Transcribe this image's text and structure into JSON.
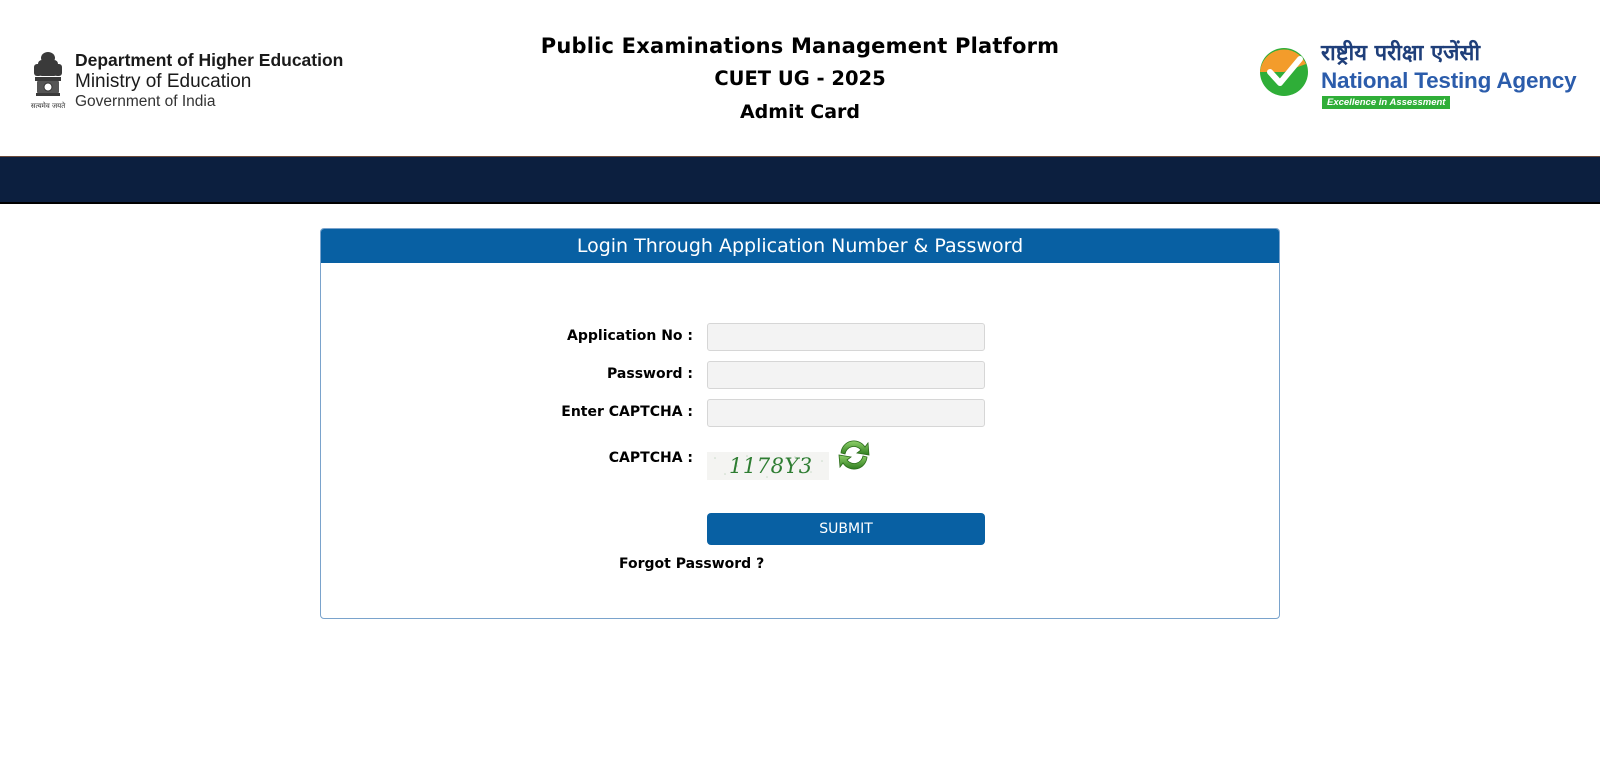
{
  "header": {
    "department": {
      "line1": "Department of Higher Education",
      "line2": "Ministry of Education",
      "line3": "Government of India",
      "emblem_caption": "सत्यमेव जयते"
    },
    "titles": {
      "platform": "Public Examinations Management Platform",
      "exam": "CUET UG - 2025",
      "document": "Admit Card"
    },
    "agency": {
      "hindi_name": "राष्ट्रीय परीक्षा एजेंसी",
      "english_name": "National Testing Agency",
      "tagline": "Excellence in Assessment"
    }
  },
  "login": {
    "heading": "Login Through Application Number & Password",
    "application_no_label": "Application No :",
    "application_no_value": "",
    "password_label": "Password :",
    "password_value": "",
    "captcha_input_label": "Enter CAPTCHA :",
    "captcha_input_value": "",
    "captcha_label": "CAPTCHA :",
    "captcha_text": "1178Y3",
    "submit_label": "SUBMIT",
    "forgot_label": "Forgot Password ?"
  },
  "colors": {
    "navbar": "#0c1f3f",
    "panel_header": "#0860a3",
    "submit": "#0860a3",
    "nta_blue": "#2b5cab",
    "nta_green": "#2fae38",
    "nta_orange": "#f39c2b",
    "captcha_text": "#2e7d32"
  },
  "icons": {
    "emblem": "national-emblem-icon",
    "nta_logo": "nta-logo-icon",
    "refresh": "refresh-icon"
  }
}
